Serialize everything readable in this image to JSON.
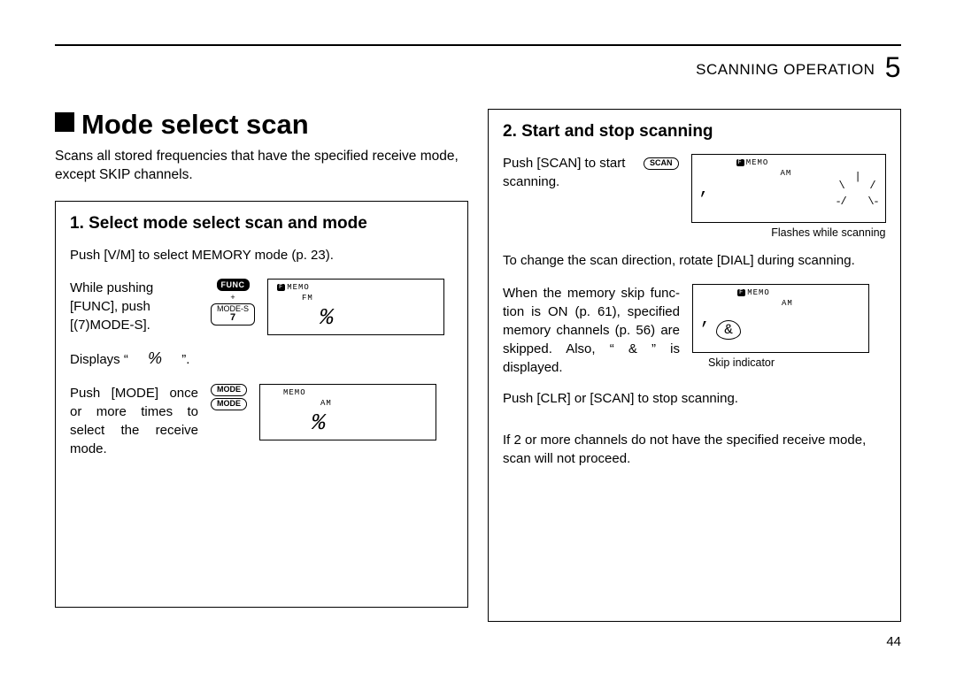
{
  "header": {
    "section": "SCANNING OPERATION",
    "chapter_num": "5"
  },
  "title": "Mode select scan",
  "intro": "Scans all stored frequencies that have the specified receive mode, except SKIP channels.",
  "panel1": {
    "heading": "1. Select mode select scan and mode",
    "step_a": "Push [V/M] to select MEMORY mode (p. 23).",
    "step_b": "While pushing [FUNC], push [(7)MODE-S].",
    "keys_b": {
      "func": "FUNC",
      "plus": "+",
      "sub": "MODE-S",
      "digit": "7"
    },
    "lcd_b": {
      "top": "MEMO",
      "sub": "FM",
      "freq": "%"
    },
    "step_c_pre": "Displays “",
    "step_c_mid": "%",
    "step_c_post": "”.",
    "step_d": "Push [MODE] once or more times to select the receive mode.",
    "keys_d": {
      "mode": "MODE"
    },
    "lcd_d": {
      "top": "MEMO",
      "sub": "AM",
      "freq": "%"
    }
  },
  "panel2": {
    "heading": "2. Start and stop scanning",
    "step_a": "Push [SCAN] to start scanning.",
    "lcd_a": {
      "scan": "SCAN",
      "top": "MEMO",
      "sub": "AM",
      "comma": ","
    },
    "cap_a": "Flashes while scanning",
    "step_b": "To change the scan direction, rotate [DIAL] during scan­ning.",
    "step_c": "When the memory skip func­tion is ON (p. 61), specified memory channels (p. 56) are skipped. Also, “ & ” is displayed.",
    "lcd_c": {
      "top": "MEMO",
      "sub": "AM",
      "comma": ",",
      "skip": "&"
    },
    "cap_c": "Skip indicator",
    "step_d": "Push [CLR] or [SCAN] to stop scanning.",
    "step_e": "If 2 or more channels do not have the specified receive mode, scan will not proceed."
  },
  "page_number": "44"
}
